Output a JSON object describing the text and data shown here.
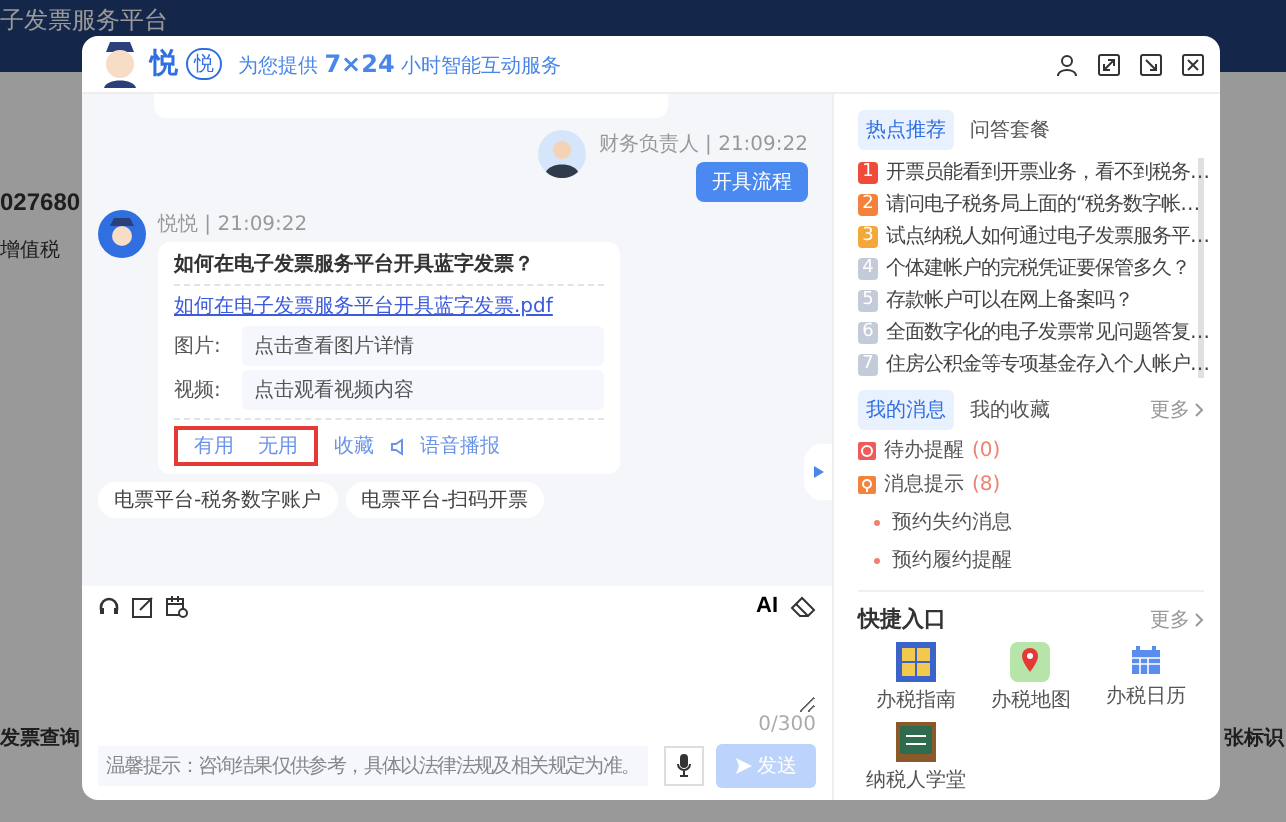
{
  "background": {
    "header_title": "子发票服务平台",
    "number": "027680",
    "subtitle": "增值税",
    "left_label": "发票查询",
    "right_label": "张标识"
  },
  "header": {
    "brand": "悦",
    "badge": "悦",
    "tagline": "为您提供 **7×24** 小时智能互动服务"
  },
  "chat": {
    "messages": [
      {
        "kind": "user",
        "sender": "财务负责人 | 21:09:22",
        "text": "开具流程"
      },
      {
        "kind": "bot",
        "sender": "悦悦 | 21:09:22",
        "title": "如何在电子发票服务平台开具蓝字发票？",
        "link": "如何在电子发票服务平台开具蓝字发票.pdf",
        "attachments": [
          {
            "label": "图片:",
            "action": "点击查看图片详情"
          },
          {
            "label": "视频:",
            "action": "点击观看视频内容"
          }
        ],
        "feedback": [
          "有用",
          "无用"
        ],
        "feedback_highlighted": true,
        "actions": [
          {
            "kind": "text",
            "label": "收藏"
          },
          {
            "kind": "speaker",
            "label": "语音播报"
          }
        ]
      }
    ],
    "suggestions": [
      "电票平台-税务数字账户",
      "电票平台-扫码开票"
    ]
  },
  "input": {
    "ai_label": "AI",
    "counter": "0/300",
    "notice": "温馨提示：咨询结果仅供参考，具体以法律法规及相关规定为准。",
    "send": "发送",
    "send_disabled": true
  },
  "hot": {
    "tabs": [
      {
        "label": "热点推荐",
        "selected": true
      },
      {
        "label": "问答套餐",
        "selected": false
      }
    ],
    "items": [
      {
        "rank": "1",
        "text": "开票员能看到开票业务，看不到税务…",
        "color": "#f04b3a"
      },
      {
        "rank": "2",
        "text": "请问电子税务局上面的“税务数字帐…",
        "color": "#f5823a"
      },
      {
        "rank": "3",
        "text": "试点纳税人如何通过电子发票服务平…",
        "color": "#f5a83a"
      },
      {
        "rank": "4",
        "text": "个体建帐户的完税凭证要保管多久？",
        "color": "#c3cad8"
      },
      {
        "rank": "5",
        "text": "存款帐户可以在网上备案吗？",
        "color": "#c3cad8"
      },
      {
        "rank": "6",
        "text": "全面数字化的电子发票常见问题答复…",
        "color": "#c3cad8"
      },
      {
        "rank": "7",
        "text": "住房公积金等专项基金存入个人帐户…",
        "color": "#c3cad8"
      }
    ]
  },
  "messages": {
    "tabs": [
      {
        "label": "我的消息",
        "selected": true
      },
      {
        "label": "我的收藏",
        "selected": false
      }
    ],
    "more": "更多",
    "counters": [
      {
        "kind": "todo",
        "label": "待办提醒",
        "count": "(0)"
      },
      {
        "kind": "notice",
        "label": "消息提示",
        "count": "(8)"
      }
    ],
    "notices": [
      "预约失约消息",
      "预约履约提醒"
    ]
  },
  "quick_entry": {
    "title": "快捷入口",
    "more": "更多",
    "items": [
      {
        "kind": "guide",
        "label": "办税指南"
      },
      {
        "kind": "map",
        "label": "办税地图"
      },
      {
        "kind": "calendar",
        "label": "办税日历"
      },
      {
        "kind": "school",
        "label": "纳税人学堂"
      }
    ]
  }
}
